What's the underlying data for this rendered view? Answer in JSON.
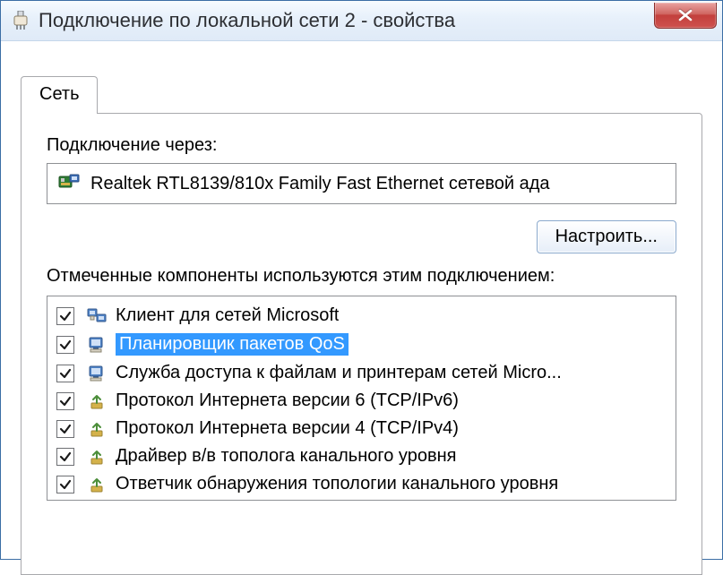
{
  "window": {
    "title": "Подключение по локальной сети 2 - свойства"
  },
  "tab": {
    "label": "Сеть"
  },
  "adapter": {
    "label": "Подключение через:",
    "name": "Realtek RTL8139/810x Family Fast Ethernet сетевой ада"
  },
  "buttons": {
    "configure": "Настроить..."
  },
  "components": {
    "label": "Отмеченные компоненты используются этим подключением:",
    "items": [
      {
        "label": "Клиент для сетей Microsoft",
        "icon": "client",
        "checked": true,
        "selected": false
      },
      {
        "label": "Планировщик пакетов QoS",
        "icon": "service",
        "checked": true,
        "selected": true
      },
      {
        "label": "Служба доступа к файлам и принтерам сетей Micro...",
        "icon": "service",
        "checked": true,
        "selected": false
      },
      {
        "label": "Протокол Интернета версии 6 (TCP/IPv6)",
        "icon": "protocol",
        "checked": true,
        "selected": false
      },
      {
        "label": "Протокол Интернета версии 4 (TCP/IPv4)",
        "icon": "protocol",
        "checked": true,
        "selected": false
      },
      {
        "label": "Драйвер в/в тополога канального уровня",
        "icon": "protocol",
        "checked": true,
        "selected": false
      },
      {
        "label": "Ответчик обнаружения топологии канального уровня",
        "icon": "protocol",
        "checked": true,
        "selected": false
      }
    ]
  }
}
